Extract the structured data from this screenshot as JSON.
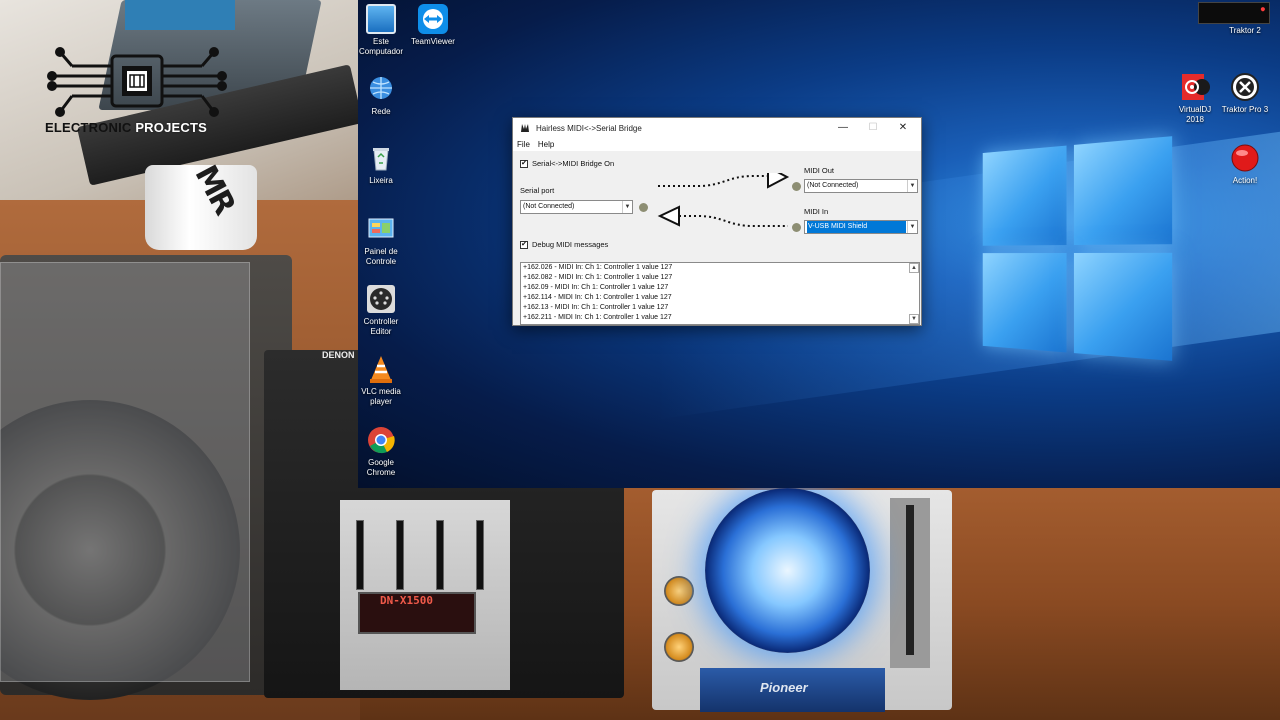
{
  "channel": {
    "logo_word_1": "ELECTRONIC",
    "logo_word_2": "PROJECTS"
  },
  "scene": {
    "mug_text": "MR",
    "mixer_brand": "DENON",
    "mixer_model": "DN-X1500",
    "cdj_brand": "Pioneer"
  },
  "desktop": {
    "icons_left": [
      {
        "name": "este-computador",
        "label1": "Este",
        "label2": "Computador"
      },
      {
        "name": "teamviewer",
        "label1": "TeamViewer",
        "label2": ""
      },
      {
        "name": "rede",
        "label1": "Rede",
        "label2": ""
      },
      {
        "name": "lixeira",
        "label1": "Lixeira",
        "label2": ""
      },
      {
        "name": "painel-de-controle",
        "label1": "Painel de",
        "label2": "Controle"
      },
      {
        "name": "controller-editor",
        "label1": "Controller",
        "label2": "Editor"
      },
      {
        "name": "vlc",
        "label1": "VLC media",
        "label2": "player"
      },
      {
        "name": "chrome",
        "label1": "Google",
        "label2": "Chrome"
      }
    ],
    "icons_right": [
      {
        "name": "traktor-2",
        "label1": "Traktor 2",
        "label2": ""
      },
      {
        "name": "virtualdj",
        "label1": "VirtualDJ",
        "label2": "2018"
      },
      {
        "name": "traktor-pro-3",
        "label1": "Traktor Pro 3",
        "label2": ""
      },
      {
        "name": "action",
        "label1": "Action!",
        "label2": ""
      }
    ]
  },
  "window": {
    "title": "Hairless MIDI<->Serial Bridge",
    "menu": [
      "File",
      "Help"
    ],
    "minimize": "—",
    "maximize": "☐",
    "close": "✕",
    "bridge_checkbox_label": "Serial<->MIDI Bridge On",
    "bridge_checked": true,
    "serial_port_label": "Serial port",
    "serial_port_value": "(Not Connected)",
    "midi_out_label": "MIDI Out",
    "midi_out_value": "(Not Connected)",
    "midi_in_label": "MIDI In",
    "midi_in_value": "V-USB MIDI Shield",
    "debug_checkbox_label": "Debug MIDI messages",
    "debug_checked": true,
    "log_lines": [
      "+162.026 - MIDI In: Ch 1: Controller 1 value 127",
      "+162.082 - MIDI In: Ch 1: Controller 1 value 127",
      "+162.09 - MIDI In: Ch 1: Controller 1 value 127",
      "+162.114 - MIDI In: Ch 1: Controller 1 value 127",
      "+162.13 - MIDI In: Ch 1: Controller 1 value 127",
      "+162.211 - MIDI In: Ch 1: Controller 1 value 127"
    ]
  },
  "colors": {
    "led": "#8d8e73",
    "selection": "#0078d7",
    "desktop_blue": "#1a5fb8"
  }
}
